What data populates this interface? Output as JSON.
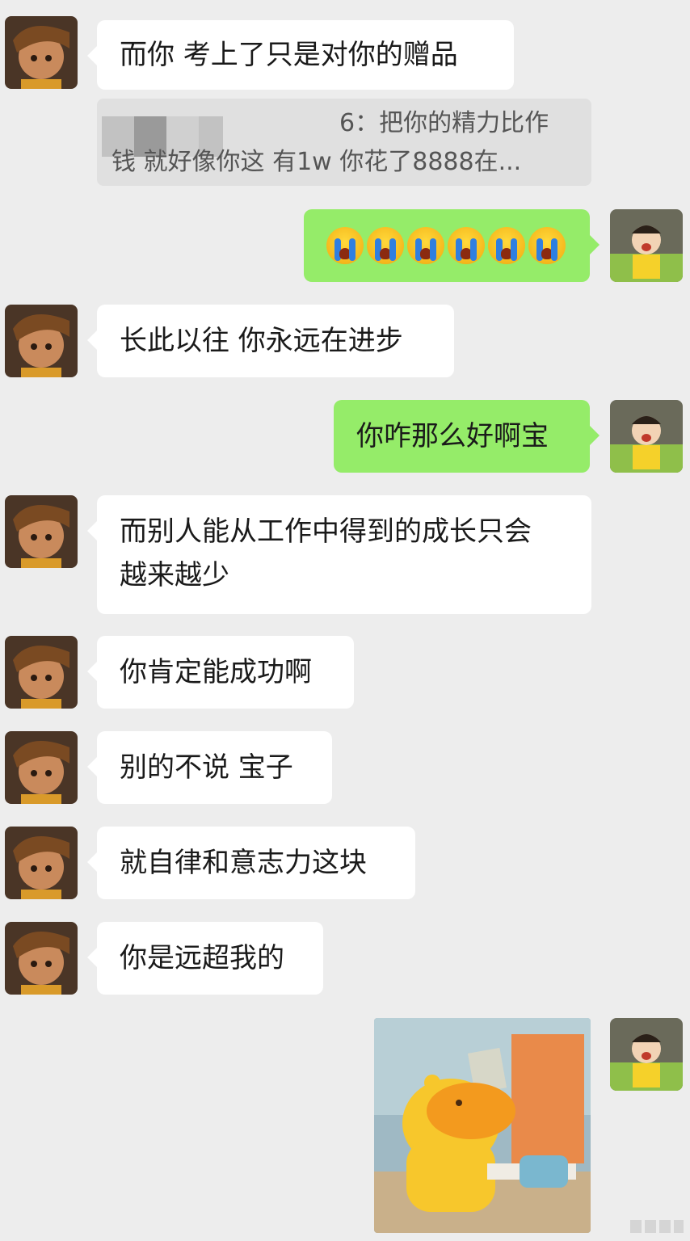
{
  "messages": [
    {
      "side": "left",
      "text": "而你 考上了只是对你的赠品"
    },
    {
      "side": "left",
      "quote_line1": "6：把你的精力比作",
      "quote_line2": "钱 就好像你这   有1w 你花了8888在..."
    },
    {
      "side": "right",
      "emoji": "loudly-crying-face",
      "emoji_count": 6
    },
    {
      "side": "left",
      "text": "长此以往 你永远在进步"
    },
    {
      "side": "right",
      "text": "你咋那么好啊宝"
    },
    {
      "side": "left",
      "line1": "而别人能从工作中得到的成长只会",
      "line2": "越来越少"
    },
    {
      "side": "left",
      "text": "你肯定能成功啊"
    },
    {
      "side": "left",
      "text": "别的不说 宝子"
    },
    {
      "side": "left",
      "text": "就自律和意志力这块"
    },
    {
      "side": "left",
      "text": "你是远超我的"
    },
    {
      "side": "right",
      "sticker": "yellow-capybara-sticker"
    }
  ],
  "colors": {
    "background": "#ededed",
    "bubble_left": "#ffffff",
    "bubble_right": "#95ec69",
    "quote_bg": "#e0e0e0"
  }
}
